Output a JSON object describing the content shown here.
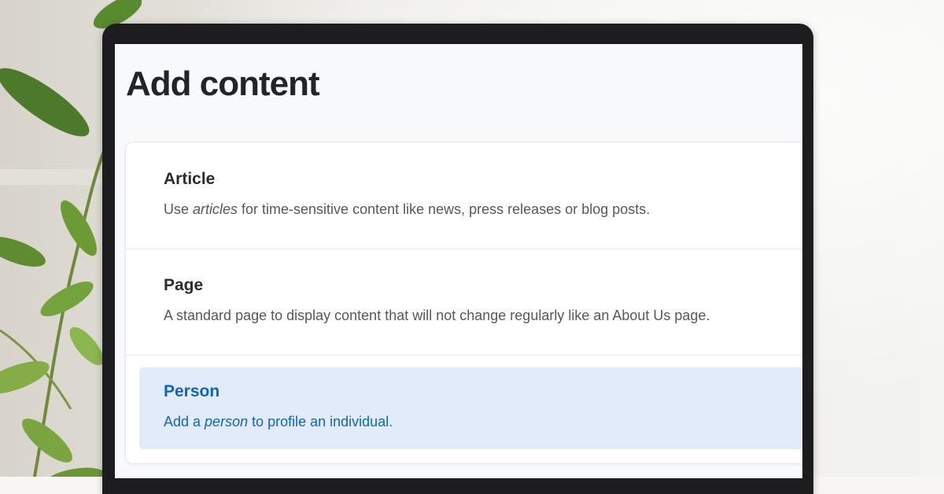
{
  "page": {
    "title": "Add content"
  },
  "content_types": [
    {
      "title": "Article",
      "desc_pre": "Use ",
      "desc_em": "articles",
      "desc_post": " for time-sensitive content like news, press releases or blog posts.",
      "highlighted": false
    },
    {
      "title": "Page",
      "desc_pre": "A standard page to display content that will not change regularly like an About Us page.",
      "desc_em": "",
      "desc_post": "",
      "highlighted": false
    },
    {
      "title": "Person",
      "desc_pre": "Add a ",
      "desc_em": "person",
      "desc_post": " to profile an individual.",
      "highlighted": true
    }
  ],
  "colors": {
    "highlight_bg": "#e2ebf9",
    "highlight_text": "#1264b8",
    "title_text": "#232429"
  }
}
